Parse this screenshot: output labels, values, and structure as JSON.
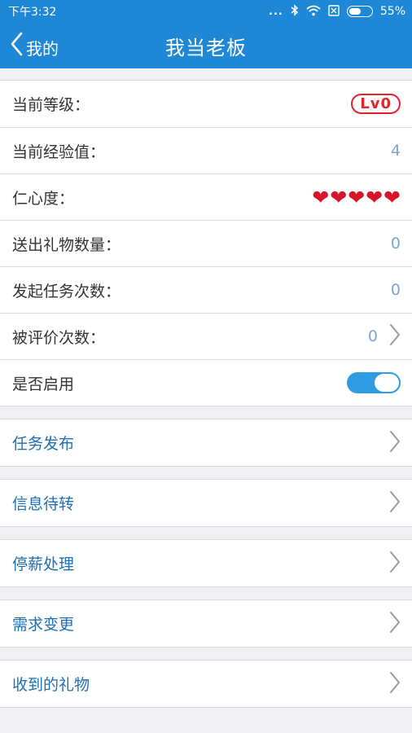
{
  "status": {
    "time": "下午3:32",
    "dots": "...",
    "battery": "55%"
  },
  "nav": {
    "back_label": "我的",
    "title": "我当老板"
  },
  "profile": {
    "level": {
      "label": "当前等级：",
      "value": "Lv0"
    },
    "exp": {
      "label": "当前经验值：",
      "value": "4"
    },
    "kindness": {
      "label": "仁心度：",
      "hearts": 5,
      "heart_glyph": "❤"
    },
    "gifts_sent": {
      "label": "送出礼物数量：",
      "value": "0"
    },
    "tasks_started": {
      "label": "发起任务次数：",
      "value": "0"
    },
    "rated": {
      "label": "被评价次数：",
      "value": "0"
    },
    "enabled": {
      "label": "是否启用",
      "on": true
    }
  },
  "menu": [
    {
      "label": "任务发布"
    },
    {
      "label": "信息待转"
    },
    {
      "label": "停薪处理"
    },
    {
      "label": "需求变更"
    },
    {
      "label": "收到的礼物"
    }
  ],
  "colors": {
    "primary": "#1e88d6",
    "link": "#1d6fb5",
    "badge": "#e8212b",
    "heart": "#d8142a"
  }
}
